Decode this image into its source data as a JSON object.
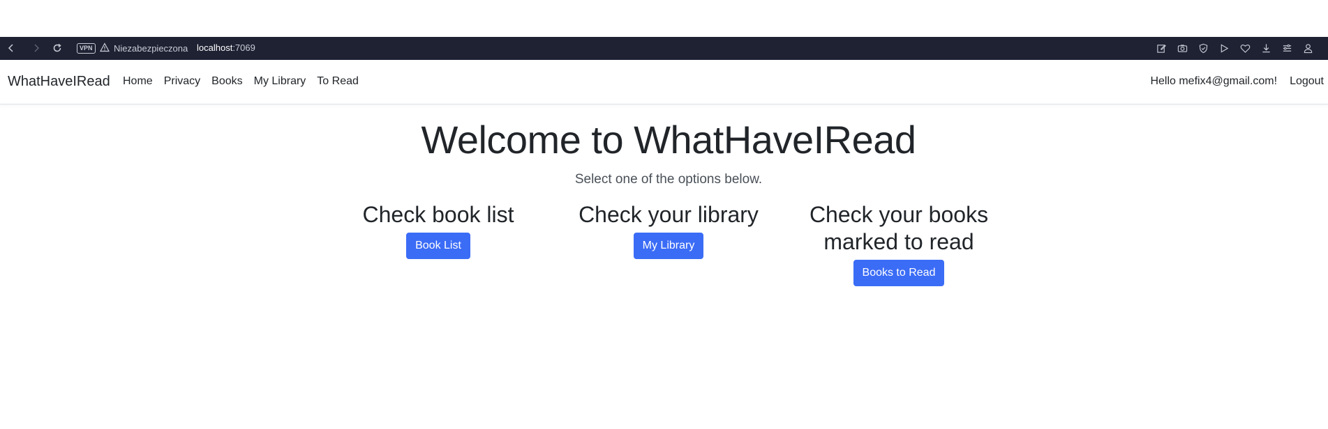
{
  "browser": {
    "vpn_label": "VPN",
    "security_text": "Niezabezpieczona",
    "url_host": "localhost",
    "url_port": ":7069"
  },
  "navbar": {
    "brand": "WhatHaveIRead",
    "links": [
      "Home",
      "Privacy",
      "Books",
      "My Library",
      "To Read"
    ],
    "greeting": "Hello mefix4@gmail.com!",
    "logout": "Logout"
  },
  "hero": {
    "title": "Welcome to WhatHaveIRead",
    "subtitle": "Select one of the options below."
  },
  "options": [
    {
      "heading": "Check book list",
      "button": "Book List"
    },
    {
      "heading": "Check your library",
      "button": "My Library"
    },
    {
      "heading": "Check your books marked to read",
      "button": "Books to Read"
    }
  ],
  "colors": {
    "primary_button": "#3b6cf6",
    "browser_bar": "#1f2233"
  }
}
